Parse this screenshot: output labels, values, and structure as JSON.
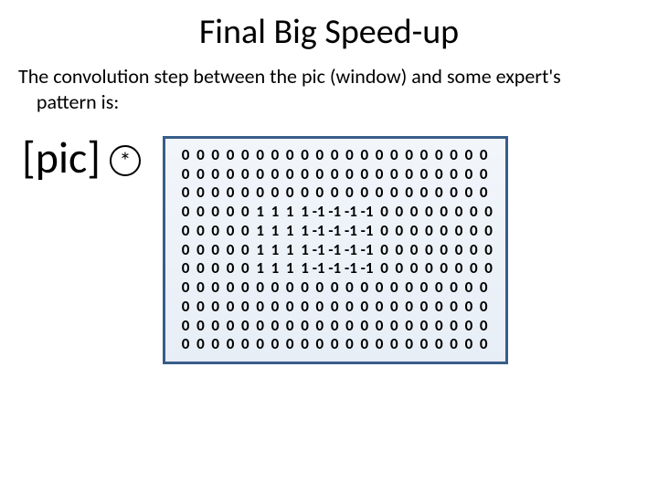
{
  "title": "Final Big Speed-up",
  "subtitle_line1": "The convolution step between the pic (window) and some  expert's",
  "subtitle_line2": "pattern is:",
  "pic_label": "[pic]",
  "conv_symbol": "*",
  "matrix_spec": {
    "rows": 11,
    "cols": 21,
    "background": 0,
    "regions": [
      {
        "row_start": 3,
        "row_end": 6,
        "col_start": 5,
        "col_end": 8,
        "value": 1
      },
      {
        "row_start": 3,
        "row_end": 6,
        "col_start": 9,
        "col_end": 12,
        "value": -1
      }
    ]
  },
  "matrix_rows": [
    " 0  0  0  0  0  0  0  0  0  0  0  0  0  0  0  0  0  0  0  0  0",
    " 0  0  0  0  0  0  0  0  0  0  0  0  0  0  0  0  0  0  0  0  0",
    " 0  0  0  0  0  0  0  0  0  0  0  0  0  0  0  0  0  0  0  0  0",
    " 0  0  0  0  0  1  1  1  1 -1 -1 -1 -1  0  0  0  0  0  0  0  0",
    " 0  0  0  0  0  1  1  1  1 -1 -1 -1 -1  0  0  0  0  0  0  0  0",
    " 0  0  0  0  0  1  1  1  1 -1 -1 -1 -1  0  0  0  0  0  0  0  0",
    " 0  0  0  0  0  1  1  1  1 -1 -1 -1 -1  0  0  0  0  0  0  0  0",
    " 0  0  0  0  0  0  0  0  0  0  0  0  0  0  0  0  0  0  0  0  0",
    " 0  0  0  0  0  0  0  0  0  0  0  0  0  0  0  0  0  0  0  0  0",
    " 0  0  0  0  0  0  0  0  0  0  0  0  0  0  0  0  0  0  0  0  0",
    " 0  0  0  0  0  0  0  0  0  0  0  0  0  0  0  0  0  0  0  0  0"
  ]
}
